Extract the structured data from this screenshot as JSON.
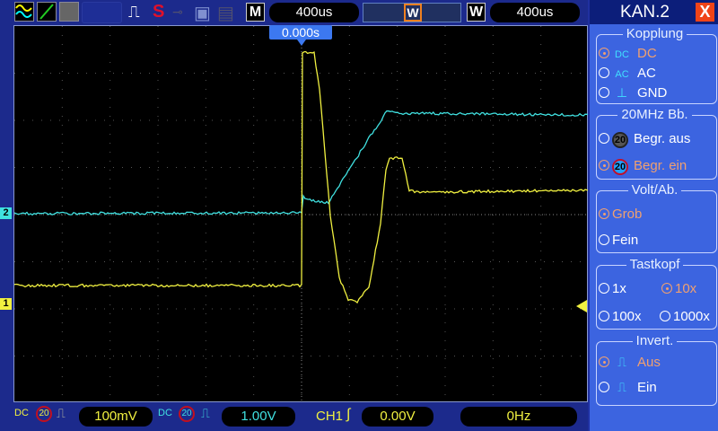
{
  "toolbar": {
    "timebase": "400us",
    "window_label": "W",
    "window_value": "400us",
    "m_label": "M",
    "s_label": "S"
  },
  "trigger_pos": "0.000s",
  "markers": {
    "ch2": "2",
    "ch1": "1"
  },
  "channels": [
    {
      "name": "CH1",
      "coupling": "DC",
      "bw": "20",
      "scale": "100mV",
      "color": "#f0f040"
    },
    {
      "name": "CH2",
      "coupling": "DC",
      "bw": "20",
      "scale": "1.00V",
      "color": "#40e0e0"
    }
  ],
  "trigger": {
    "source": "CH1",
    "level": "0.00V"
  },
  "frequency": "0Hz",
  "panel": {
    "title": "KAN.2",
    "close": "X",
    "kopplung": {
      "label": "Kopplung",
      "options": [
        {
          "icon": "DC",
          "label": "DC",
          "selected": true
        },
        {
          "icon": "AC",
          "label": "AC",
          "selected": false
        },
        {
          "icon": "GND",
          "label": "GND",
          "selected": false
        }
      ]
    },
    "bw": {
      "label": "20MHz  Bb.",
      "options": [
        {
          "icon": "20",
          "label": "Begr.  aus",
          "selected": false
        },
        {
          "icon": "20",
          "label": "Begr.  ein",
          "selected": true
        }
      ]
    },
    "volt": {
      "label": "Volt/Ab.",
      "options": [
        {
          "label": "Grob",
          "selected": true
        },
        {
          "label": "Fein",
          "selected": false
        }
      ]
    },
    "tastkopf": {
      "label": "Tastkopf",
      "options": [
        {
          "label": "1x",
          "selected": false
        },
        {
          "label": "10x",
          "selected": true
        },
        {
          "label": "100x",
          "selected": false
        },
        {
          "label": "1000x",
          "selected": false
        }
      ]
    },
    "invert": {
      "label": "Invert.",
      "options": [
        {
          "label": "Aus",
          "selected": true
        },
        {
          "label": "Ein",
          "selected": false
        }
      ]
    }
  }
}
